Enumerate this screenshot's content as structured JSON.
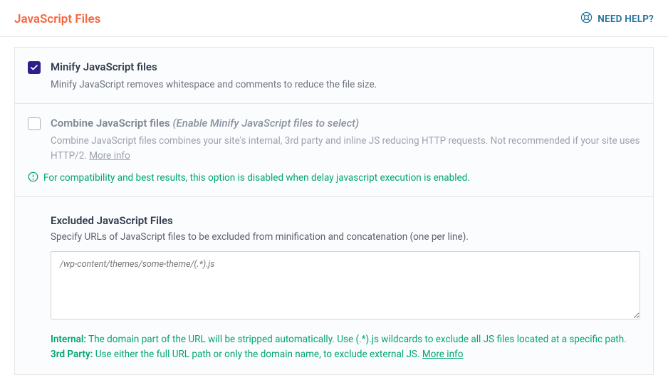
{
  "header": {
    "title": "JavaScript Files",
    "help_label": "NEED HELP?"
  },
  "minify": {
    "title": "Minify JavaScript files",
    "desc": "Minify JavaScript removes whitespace and comments to reduce the file size."
  },
  "combine": {
    "title": "Combine JavaScript files",
    "enable_hint": "(Enable Minify JavaScript files to select)",
    "desc": "Combine JavaScript files combines your site's internal, 3rd party and inline JS reducing HTTP requests. Not recommended if your site uses HTTP/2.",
    "more_info": "More info"
  },
  "notice": {
    "text": "For compatibility and best results, this option is disabled when delay javascript execution is enabled."
  },
  "excluded": {
    "title": "Excluded JavaScript Files",
    "desc": "Specify URLs of JavaScript files to be excluded from minification and concatenation (one per line).",
    "placeholder": "/wp-content/themes/some-theme/(.*).js"
  },
  "hints": {
    "internal_label": "Internal:",
    "internal_text": " The domain part of the URL will be stripped automatically. Use (.*).js wildcards to exclude all JS files located at a specific path.",
    "third_label": "3rd Party:",
    "third_text": " Use either the full URL path or only the domain name, to exclude external JS. ",
    "more_info": "More info"
  }
}
